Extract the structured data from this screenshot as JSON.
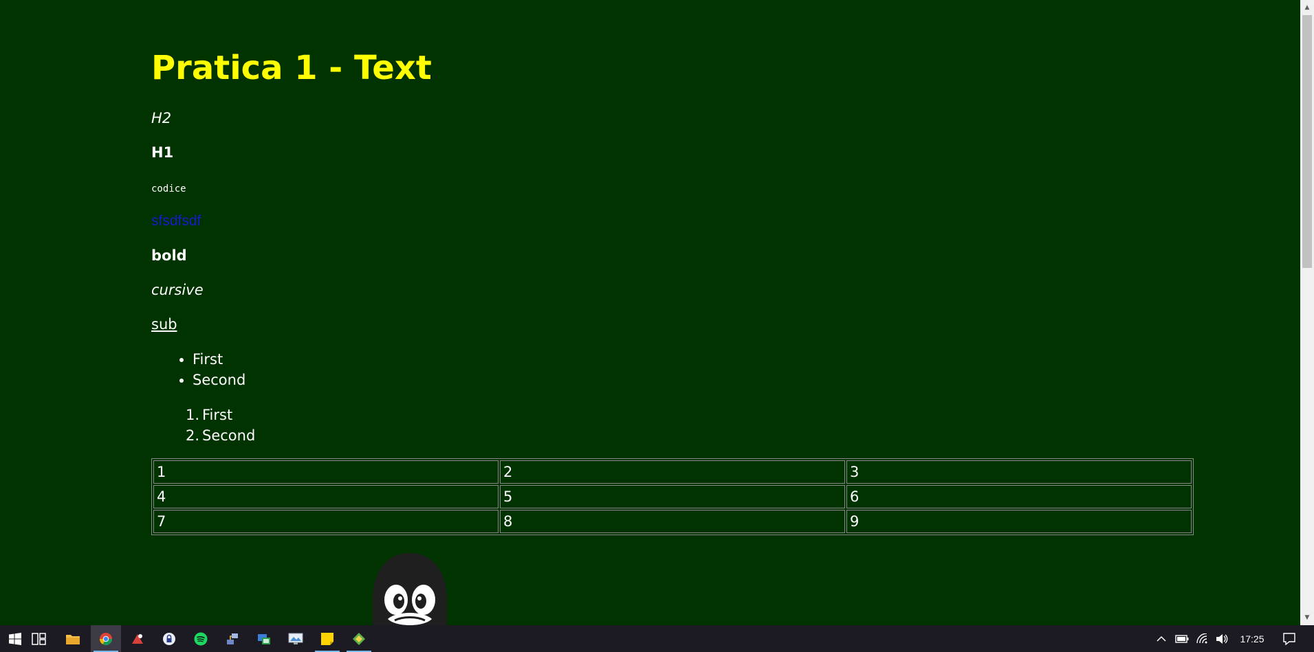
{
  "page": {
    "title": "Pratica 1 - Text",
    "h2_text": "H2",
    "h1_text": "H1",
    "code_text": "codice",
    "link_text": "sfsdfsdf",
    "bold_text": "bold",
    "cursive_text": "cursive",
    "sub_text": "sub",
    "bullet_list": [
      "First",
      "Second"
    ],
    "ordered_list": [
      {
        "num": "1.",
        "label": "First"
      },
      {
        "num": "2.",
        "label": "Second"
      }
    ],
    "table": [
      [
        "1",
        "2",
        "3"
      ],
      [
        "4",
        "5",
        "6"
      ],
      [
        "7",
        "8",
        "9"
      ]
    ]
  },
  "colors": {
    "background": "#003300",
    "title": "#ffff00",
    "text": "#ffffff",
    "link": "#1a1acc"
  },
  "taskbar": {
    "icons": [
      "windows-start-icon",
      "task-view-icon",
      "file-explorer-icon",
      "chrome-icon",
      "app-red-icon",
      "security-app-icon",
      "spotify-icon",
      "network-tool-icon",
      "remote-app-icon",
      "screen-app-icon",
      "sticky-notes-icon",
      "dev-tool-icon"
    ],
    "clock": "17:25"
  }
}
